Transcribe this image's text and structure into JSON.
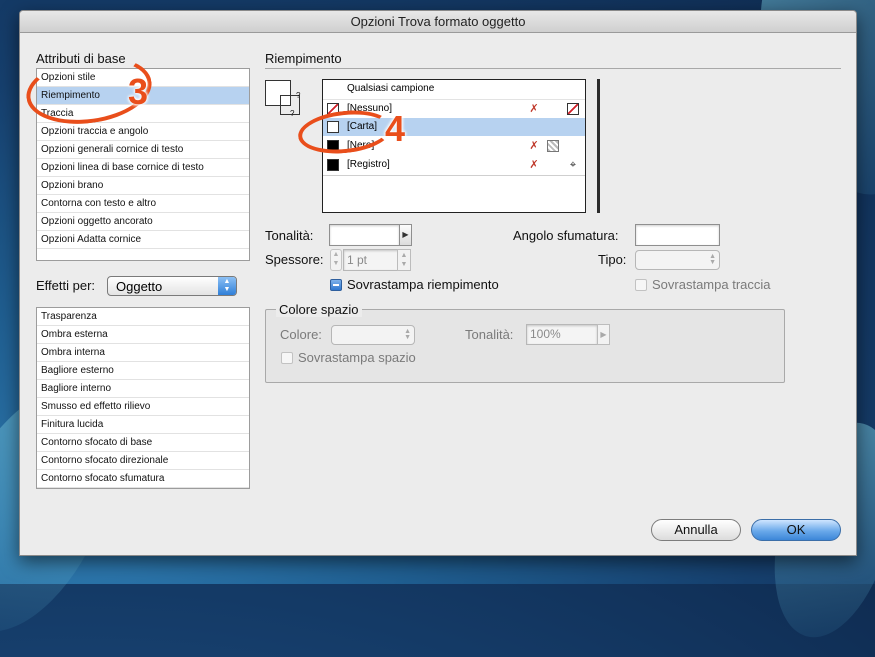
{
  "window": {
    "title": "Opzioni Trova formato oggetto"
  },
  "left_panel": {
    "title": "Attributi di base",
    "attributes": [
      "Opzioni stile",
      "Riempimento",
      "Traccia",
      "Opzioni traccia e angolo",
      "Opzioni generali cornice di testo",
      "Opzioni linea di base cornice di testo",
      "Opzioni brano",
      "Contorna con testo e altro",
      "Opzioni oggetto ancorato",
      "Opzioni Adatta cornice"
    ],
    "selected_index": 1,
    "effects_label": "Effetti per:",
    "effects_target": "Oggetto",
    "effects": [
      "Trasparenza",
      "Ombra esterna",
      "Ombra interna",
      "Bagliore esterno",
      "Bagliore interno",
      "Smusso ed effetto rilievo",
      "Finitura lucida",
      "Contorno sfocato di base",
      "Contorno sfocato direzionale",
      "Contorno sfocato sfumatura"
    ]
  },
  "fill_panel": {
    "title": "Riempimento",
    "swatches": {
      "header": "Qualsiasi campione",
      "items": [
        {
          "name": "[Nessuno]",
          "chip": "none"
        },
        {
          "name": "[Carta]",
          "chip": "paper",
          "selected": true
        },
        {
          "name": "[Nero]",
          "chip": "black"
        },
        {
          "name": "[Registro]",
          "chip": "black"
        }
      ]
    },
    "tint_label": "Tonalità:",
    "tint_value": "",
    "gradient_angle_label": "Angolo sfumatura:",
    "gradient_angle_value": "",
    "weight_label": "Spessore:",
    "weight_value": "1 pt",
    "type_label": "Tipo:",
    "overprint_fill_label": "Sovrastampa riempimento",
    "overprint_stroke_label": "Sovrastampa traccia",
    "gap": {
      "title": "Colore spazio",
      "color_label": "Colore:",
      "tint_label": "Tonalità:",
      "tint_value": "100%",
      "overprint_label": "Sovrastampa spazio"
    }
  },
  "buttons": {
    "cancel": "Annulla",
    "ok": "OK"
  },
  "annotations": {
    "left_number": "3",
    "right_number": "4"
  },
  "colors": {
    "accent": "#e94e1b",
    "selection": "#b7d2f0",
    "ok_button": "#3c86d8"
  }
}
